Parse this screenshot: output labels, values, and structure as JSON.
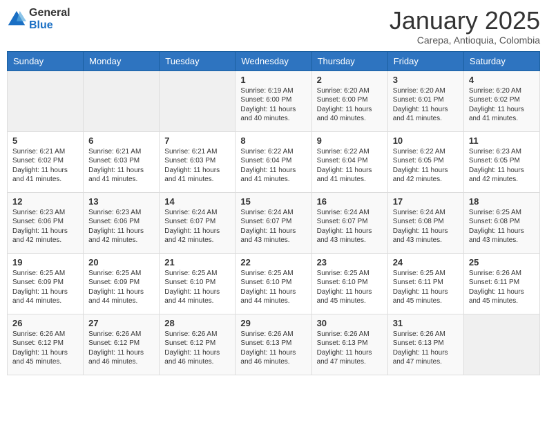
{
  "logo": {
    "general": "General",
    "blue": "Blue"
  },
  "header": {
    "month": "January 2025",
    "location": "Carepa, Antioquia, Colombia"
  },
  "weekdays": [
    "Sunday",
    "Monday",
    "Tuesday",
    "Wednesday",
    "Thursday",
    "Friday",
    "Saturday"
  ],
  "weeks": [
    [
      {
        "day": "",
        "info": ""
      },
      {
        "day": "",
        "info": ""
      },
      {
        "day": "",
        "info": ""
      },
      {
        "day": "1",
        "info": "Sunrise: 6:19 AM\nSunset: 6:00 PM\nDaylight: 11 hours and 40 minutes."
      },
      {
        "day": "2",
        "info": "Sunrise: 6:20 AM\nSunset: 6:00 PM\nDaylight: 11 hours and 40 minutes."
      },
      {
        "day": "3",
        "info": "Sunrise: 6:20 AM\nSunset: 6:01 PM\nDaylight: 11 hours and 41 minutes."
      },
      {
        "day": "4",
        "info": "Sunrise: 6:20 AM\nSunset: 6:02 PM\nDaylight: 11 hours and 41 minutes."
      }
    ],
    [
      {
        "day": "5",
        "info": "Sunrise: 6:21 AM\nSunset: 6:02 PM\nDaylight: 11 hours and 41 minutes."
      },
      {
        "day": "6",
        "info": "Sunrise: 6:21 AM\nSunset: 6:03 PM\nDaylight: 11 hours and 41 minutes."
      },
      {
        "day": "7",
        "info": "Sunrise: 6:21 AM\nSunset: 6:03 PM\nDaylight: 11 hours and 41 minutes."
      },
      {
        "day": "8",
        "info": "Sunrise: 6:22 AM\nSunset: 6:04 PM\nDaylight: 11 hours and 41 minutes."
      },
      {
        "day": "9",
        "info": "Sunrise: 6:22 AM\nSunset: 6:04 PM\nDaylight: 11 hours and 41 minutes."
      },
      {
        "day": "10",
        "info": "Sunrise: 6:22 AM\nSunset: 6:05 PM\nDaylight: 11 hours and 42 minutes."
      },
      {
        "day": "11",
        "info": "Sunrise: 6:23 AM\nSunset: 6:05 PM\nDaylight: 11 hours and 42 minutes."
      }
    ],
    [
      {
        "day": "12",
        "info": "Sunrise: 6:23 AM\nSunset: 6:06 PM\nDaylight: 11 hours and 42 minutes."
      },
      {
        "day": "13",
        "info": "Sunrise: 6:23 AM\nSunset: 6:06 PM\nDaylight: 11 hours and 42 minutes."
      },
      {
        "day": "14",
        "info": "Sunrise: 6:24 AM\nSunset: 6:07 PM\nDaylight: 11 hours and 42 minutes."
      },
      {
        "day": "15",
        "info": "Sunrise: 6:24 AM\nSunset: 6:07 PM\nDaylight: 11 hours and 43 minutes."
      },
      {
        "day": "16",
        "info": "Sunrise: 6:24 AM\nSunset: 6:07 PM\nDaylight: 11 hours and 43 minutes."
      },
      {
        "day": "17",
        "info": "Sunrise: 6:24 AM\nSunset: 6:08 PM\nDaylight: 11 hours and 43 minutes."
      },
      {
        "day": "18",
        "info": "Sunrise: 6:25 AM\nSunset: 6:08 PM\nDaylight: 11 hours and 43 minutes."
      }
    ],
    [
      {
        "day": "19",
        "info": "Sunrise: 6:25 AM\nSunset: 6:09 PM\nDaylight: 11 hours and 44 minutes."
      },
      {
        "day": "20",
        "info": "Sunrise: 6:25 AM\nSunset: 6:09 PM\nDaylight: 11 hours and 44 minutes."
      },
      {
        "day": "21",
        "info": "Sunrise: 6:25 AM\nSunset: 6:10 PM\nDaylight: 11 hours and 44 minutes."
      },
      {
        "day": "22",
        "info": "Sunrise: 6:25 AM\nSunset: 6:10 PM\nDaylight: 11 hours and 44 minutes."
      },
      {
        "day": "23",
        "info": "Sunrise: 6:25 AM\nSunset: 6:10 PM\nDaylight: 11 hours and 45 minutes."
      },
      {
        "day": "24",
        "info": "Sunrise: 6:25 AM\nSunset: 6:11 PM\nDaylight: 11 hours and 45 minutes."
      },
      {
        "day": "25",
        "info": "Sunrise: 6:26 AM\nSunset: 6:11 PM\nDaylight: 11 hours and 45 minutes."
      }
    ],
    [
      {
        "day": "26",
        "info": "Sunrise: 6:26 AM\nSunset: 6:12 PM\nDaylight: 11 hours and 45 minutes."
      },
      {
        "day": "27",
        "info": "Sunrise: 6:26 AM\nSunset: 6:12 PM\nDaylight: 11 hours and 46 minutes."
      },
      {
        "day": "28",
        "info": "Sunrise: 6:26 AM\nSunset: 6:12 PM\nDaylight: 11 hours and 46 minutes."
      },
      {
        "day": "29",
        "info": "Sunrise: 6:26 AM\nSunset: 6:13 PM\nDaylight: 11 hours and 46 minutes."
      },
      {
        "day": "30",
        "info": "Sunrise: 6:26 AM\nSunset: 6:13 PM\nDaylight: 11 hours and 47 minutes."
      },
      {
        "day": "31",
        "info": "Sunrise: 6:26 AM\nSunset: 6:13 PM\nDaylight: 11 hours and 47 minutes."
      },
      {
        "day": "",
        "info": ""
      }
    ]
  ]
}
